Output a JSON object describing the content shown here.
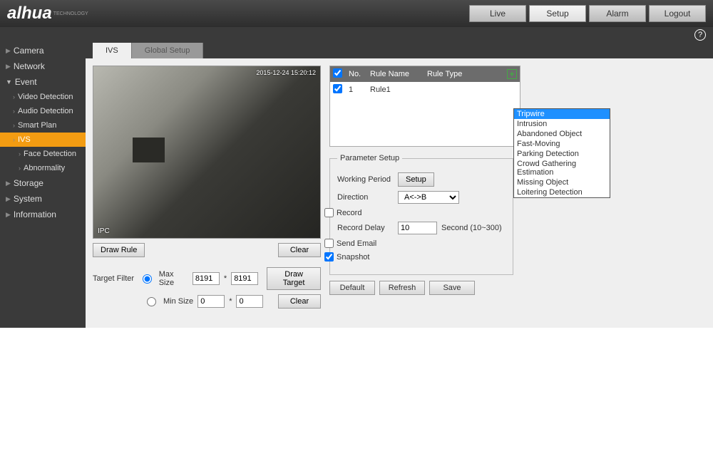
{
  "brand": "alhua",
  "brand_sub": "TECHNOLOGY",
  "nav": {
    "live": "Live",
    "setup": "Setup",
    "alarm": "Alarm",
    "logout": "Logout"
  },
  "sidebar": {
    "camera": "Camera",
    "network": "Network",
    "event": "Event",
    "video_det": "Video Detection",
    "audio_det": "Audio Detection",
    "smart_plan": "Smart Plan",
    "ivs": "IVS",
    "face_det": "Face Detection",
    "abnormality": "Abnormality",
    "storage": "Storage",
    "system": "System",
    "information": "Information"
  },
  "tabs": {
    "ivs": "IVS",
    "global": "Global Setup"
  },
  "video": {
    "timestamp": "2015-12-24 15:20:12",
    "label": "IPC"
  },
  "left": {
    "draw_rule": "Draw Rule",
    "clear": "Clear",
    "target_filter": "Target Filter",
    "max_size": "Max Size",
    "min_size": "Min Size",
    "max_w": "8191",
    "max_h": "8191",
    "min_w": "0",
    "min_h": "0",
    "draw_target": "Draw Target"
  },
  "rule_cols": {
    "no": "No.",
    "name": "Rule Name",
    "type": "Rule Type"
  },
  "rule_row": {
    "no": "1",
    "name": "Rule1"
  },
  "rule_types": [
    "Tripwire",
    "Intrusion",
    "Abandoned Object",
    "Fast-Moving",
    "Parking Detection",
    "Crowd Gathering Estimation",
    "Missing Object",
    "Loitering Detection"
  ],
  "param": {
    "legend": "Parameter Setup",
    "working_period": "Working Period",
    "setup": "Setup",
    "direction": "Direction",
    "direction_val": "A<->B",
    "record": "Record",
    "record_delay": "Record Delay",
    "record_delay_val": "10",
    "record_delay_unit": "Second (10~300)",
    "send_email": "Send Email",
    "snapshot": "Snapshot"
  },
  "footer": {
    "default": "Default",
    "refresh": "Refresh",
    "save": "Save"
  }
}
